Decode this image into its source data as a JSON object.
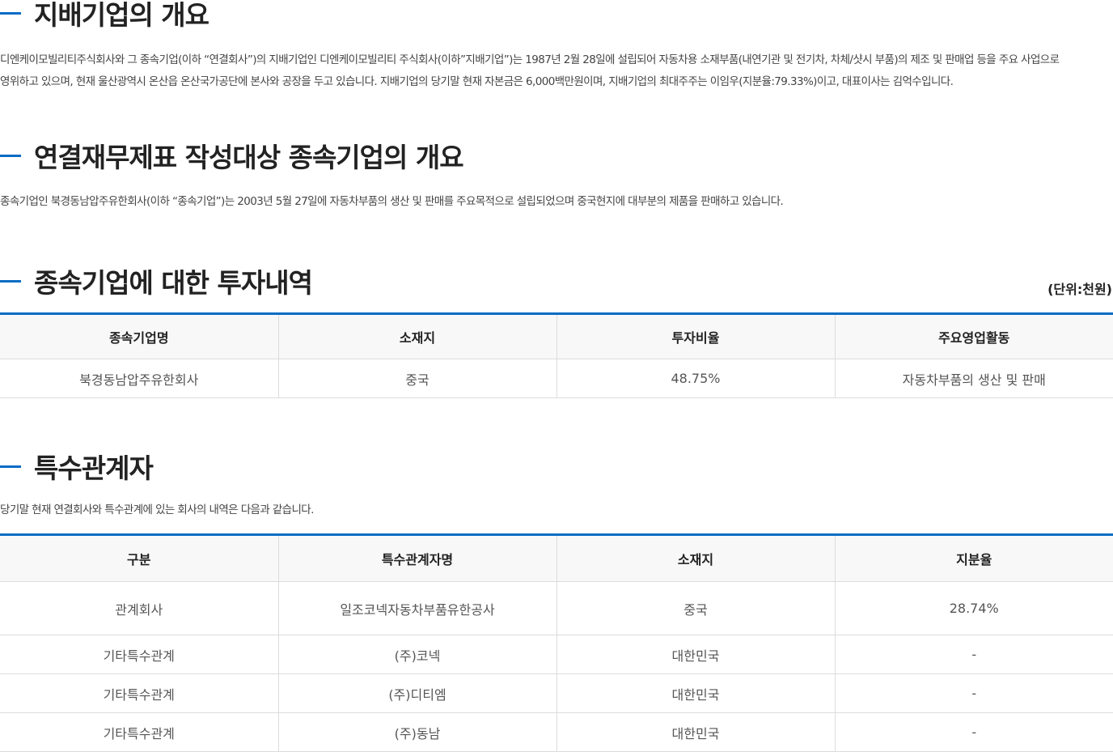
{
  "section1": {
    "title": "지배기업의 개요",
    "line1": "디엔케이모빌리티주식회사와 그 종속기업(이하 “연결회사”)의 지배기업인 디엔케이모빌리티 주식회사(이하”지배기업”)는 1987년 2월 28일에 설립되어 자동차용 소재부품(내연기관 및 전기차, 차체/샷시 부품)의 제조 및 판매업 등을 주요 사업으로",
    "line2": "영위하고 있으며, 현재 울산광역시 온산읍 온산국가공단에 본사와 공장을 두고 있습니다. 지배기업의 당기말 현재 자본금은 6,000백만원이며, 지배기업의 최대주주는 이임우(지분율:79.33%)이고, 대표이사는 김억수입니다."
  },
  "section2": {
    "title": "연결재무제표 작성대상 종속기업의 개요",
    "text": "종속기업인 북경동남압주유한회사(이하 “종속기업”)는 2003년 5월 27일에 자동차부품의 생산 및 판매를 주요목적으로 설립되었으며 중국현지에  대부분의 제품을 판매하고 있습니다."
  },
  "section3": {
    "title": "종속기업에 대한 투자내역",
    "unit": "(단위:천원)",
    "headers": [
      "종속기업명",
      "소재지",
      "투자비율",
      "주요영업활동"
    ],
    "rows": [
      [
        "북경동남압주유한회사",
        "중국",
        "48.75%",
        "자동차부품의 생산 및 판매"
      ]
    ]
  },
  "section4": {
    "title": "특수관계자",
    "text": "당기말 현재 연결회사와 특수관계에 있는 회사의 내역은 다음과 같습니다.",
    "headers": [
      "구분",
      "특수관계자명",
      "소재지",
      "지분율"
    ],
    "rows": [
      [
        "관계회사",
        "일조코넥자동차부품유한공사",
        "중국",
        "28.74%"
      ],
      [
        "기타특수관계",
        "(주)코넥",
        "대한민국",
        "-"
      ],
      [
        "기타특수관계",
        "(주)디티엠",
        "대한민국",
        "-"
      ],
      [
        "기타특수관계",
        "(주)동남",
        "대한민국",
        "-"
      ]
    ]
  },
  "colors": {
    "accent": "#0a6cc4",
    "header_bg": "#f8f8f8",
    "border": "#dcdcdc"
  }
}
